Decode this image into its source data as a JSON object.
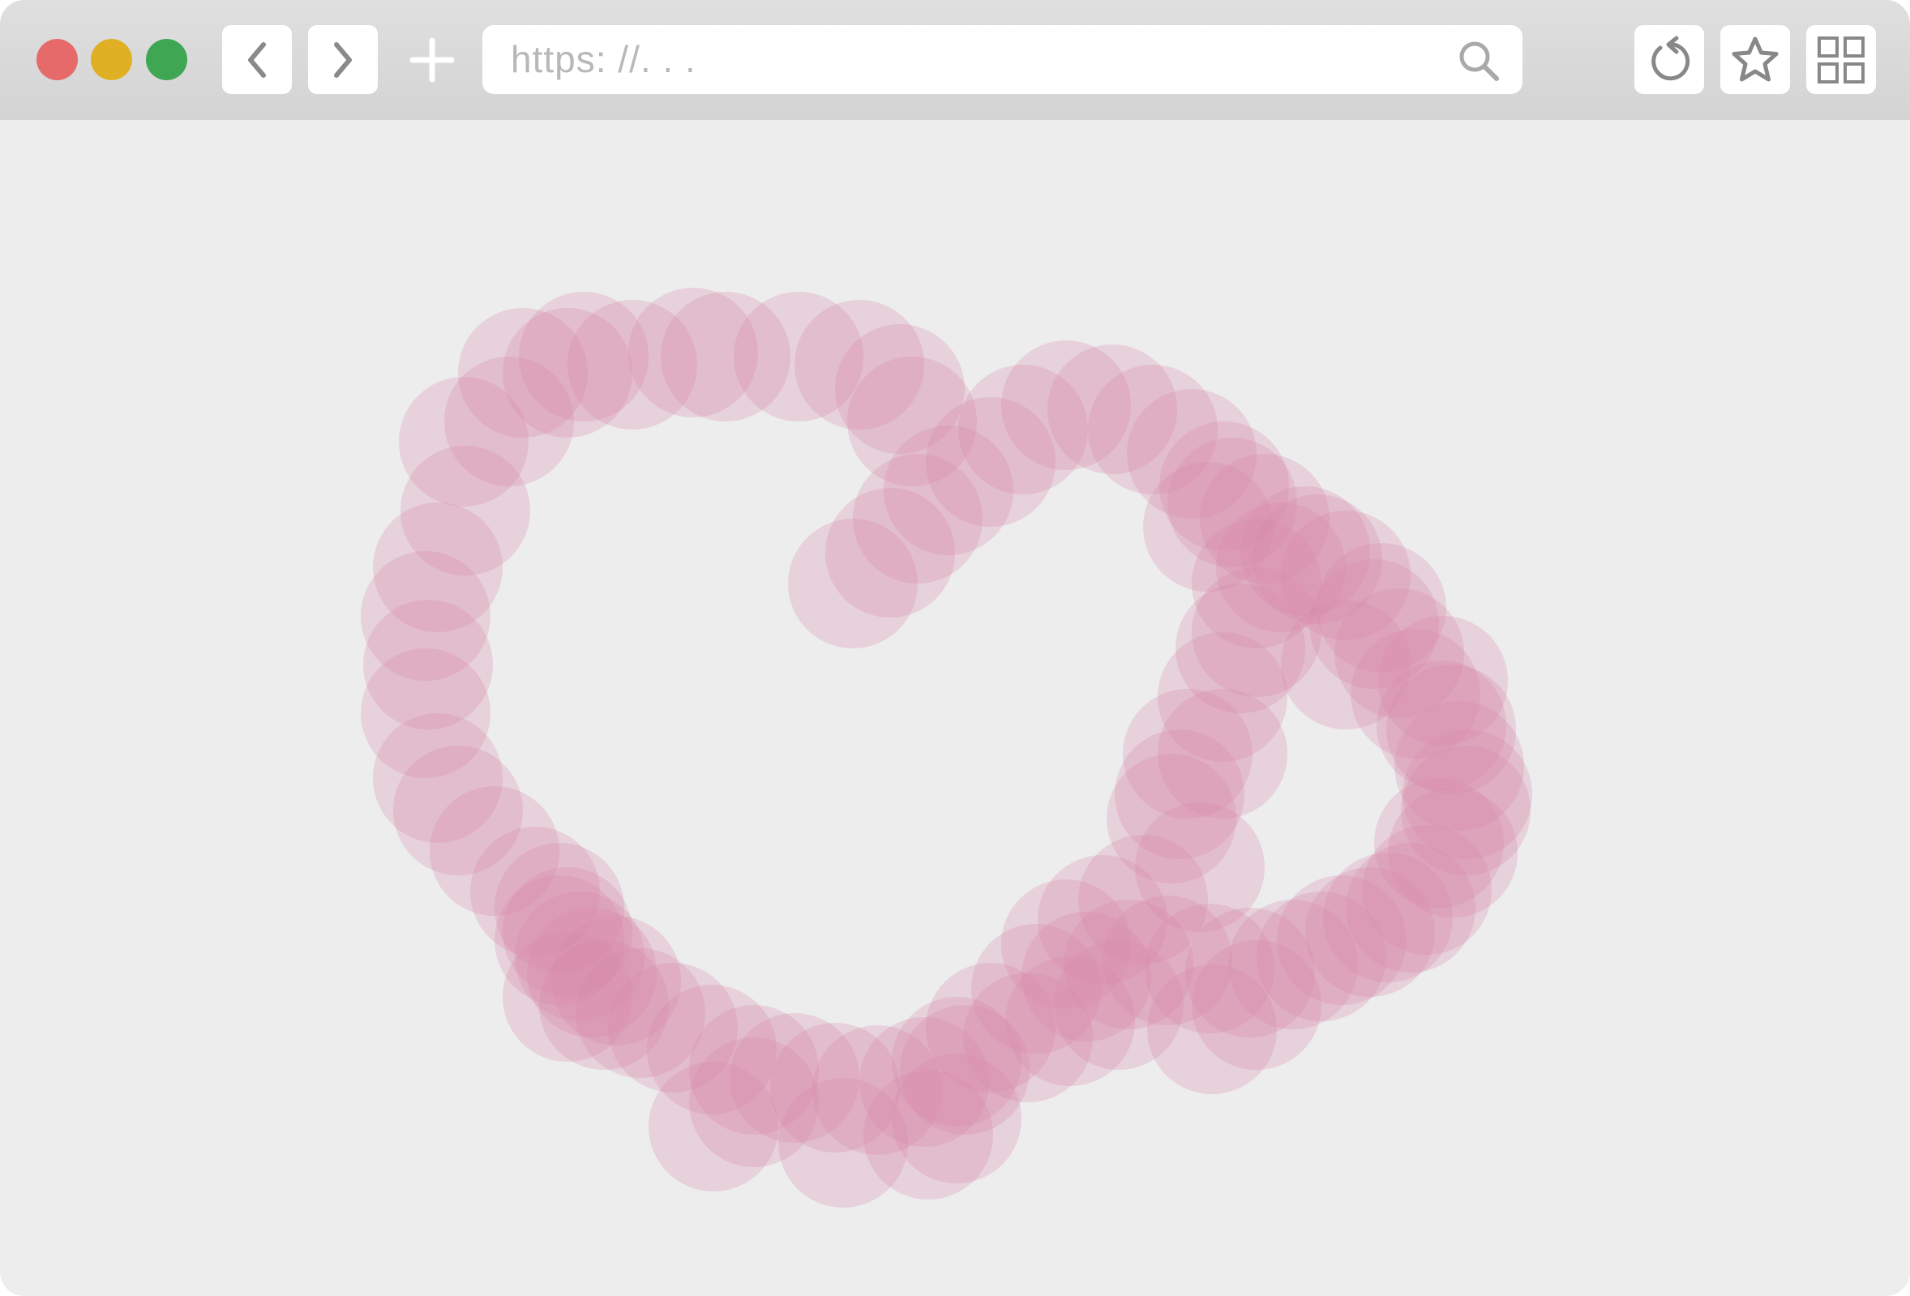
{
  "browser": {
    "url_placeholder": "https: //. . .",
    "traffic_lights": {
      "close_color": "#e66a6a",
      "minimize_color": "#e0b024",
      "maximize_color": "#3fa653"
    },
    "icons": {
      "back": "chevron-left-icon",
      "forward": "chevron-right-icon",
      "new_tab": "plus-icon",
      "search": "search-icon",
      "reload": "reload-icon",
      "bookmark": "star-icon",
      "tabs_grid": "grid-icon"
    }
  },
  "content": {
    "artwork": "pink-circle-spiral",
    "circle_color": "#d98aa8"
  }
}
